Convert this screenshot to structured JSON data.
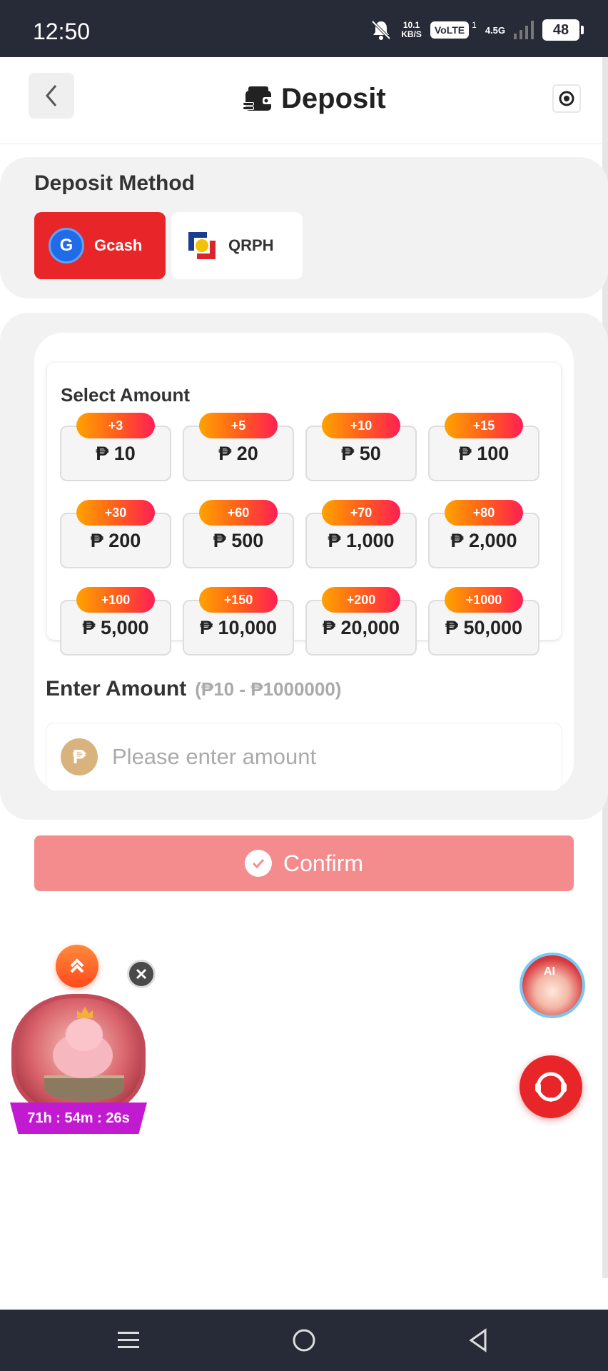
{
  "status_bar": {
    "time": "12:50",
    "net_speed_value": "10.1",
    "net_speed_unit": "KB/S",
    "volte": "VoLTE",
    "sim_slot": "1",
    "network": "4.5G",
    "battery": "48",
    "icons": [
      "bell-muted-icon",
      "signal-icon",
      "battery-icon"
    ]
  },
  "header": {
    "title": "Deposit",
    "icons": [
      "back-icon",
      "wallet-icon",
      "screen-record-icon"
    ]
  },
  "deposit_method": {
    "heading": "Deposit Method",
    "methods": [
      {
        "label": "Gcash",
        "logo": "G",
        "selected": true
      },
      {
        "label": "QRPH",
        "selected": false
      }
    ]
  },
  "select_amount": {
    "heading": "Select Amount",
    "options": [
      {
        "amount": "₱ 10",
        "bonus": "+3"
      },
      {
        "amount": "₱ 20",
        "bonus": "+5"
      },
      {
        "amount": "₱ 50",
        "bonus": "+10"
      },
      {
        "amount": "₱ 100",
        "bonus": "+15"
      },
      {
        "amount": "₱ 200",
        "bonus": "+30"
      },
      {
        "amount": "₱ 500",
        "bonus": "+60"
      },
      {
        "amount": "₱ 1,000",
        "bonus": "+70"
      },
      {
        "amount": "₱ 2,000",
        "bonus": "+80"
      },
      {
        "amount": "₱ 5,000",
        "bonus": "+100"
      },
      {
        "amount": "₱ 10,000",
        "bonus": "+150"
      },
      {
        "amount": "₱ 20,000",
        "bonus": "+200"
      },
      {
        "amount": "₱ 50,000",
        "bonus": "+1000"
      }
    ]
  },
  "enter_amount": {
    "title": "Enter Amount",
    "range": "(₱10 - ₱1000000)",
    "currency_symbol": "₱",
    "placeholder": "Please enter amount",
    "value": ""
  },
  "confirm": {
    "label": "Confirm"
  },
  "floating": {
    "promo_timer": "71h : 54m : 26s",
    "ai_label": "AI",
    "icons": [
      "chevrons-up-icon",
      "close-icon",
      "pig-promo-icon",
      "ai-assistant-icon",
      "headset-icon"
    ]
  },
  "colors": {
    "accent": "#e8262a",
    "confirm": "#f48c8e",
    "badge_start": "#ffa200",
    "badge_end": "#ff1f55",
    "status_bar": "#272a37",
    "panel": "#f2f2f2"
  }
}
